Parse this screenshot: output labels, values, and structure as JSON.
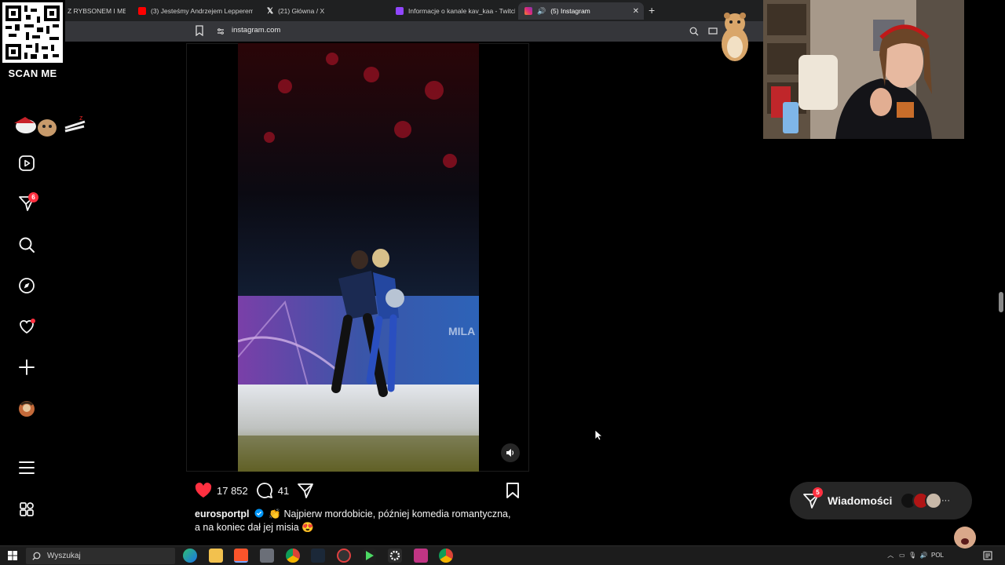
{
  "browser": {
    "tabs": [
      {
        "label": "Z RYBSONEM I MED",
        "active": false
      },
      {
        "label": "(3) Jesteśmy Andrzejem Lepperem! (",
        "active": false
      },
      {
        "label": "(21) Główna / X",
        "active": false
      },
      {
        "label": "Informacje o kanale kav_kaa - Twitch",
        "active": false
      },
      {
        "label": "(5) Instagram",
        "active": true
      }
    ],
    "url": "instagram.com"
  },
  "overlay": {
    "qr_label": "SCAN ME"
  },
  "sidebar": {
    "messages_badge": "6",
    "items": [
      "reels-icon",
      "direct-icon",
      "search-icon",
      "explore-icon",
      "notifications-icon",
      "create-icon",
      "profile-icon",
      "more-icon",
      "also-from-meta-icon"
    ]
  },
  "post": {
    "likes": "17 852",
    "comments": "41",
    "username": "eurosportpl",
    "caption_line1": "👏 Najpierw mordobicie, później komedia romantyczna,",
    "caption_line2": "a na koniec dał jej misia 😍"
  },
  "messages": {
    "label": "Wiadomości",
    "badge": "5"
  },
  "taskbar": {
    "search_placeholder": "Wyszukaj",
    "lang": "POL"
  },
  "colors": {
    "like": "#ff3040",
    "badge": "#ff3040",
    "background": "#000000"
  }
}
